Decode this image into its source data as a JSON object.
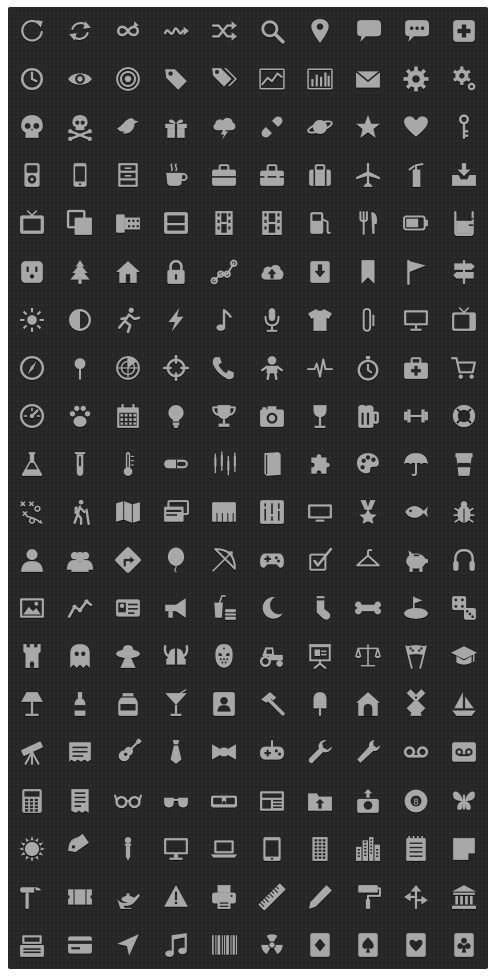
{
  "icon_set": {
    "colors": {
      "background": "#262626",
      "icon_fill": "#a8a8a8",
      "icon_shadow": "#111111",
      "page": "#ffffff"
    },
    "rows": [
      [
        "refresh-icon",
        "sync-icon",
        "repeat-icon",
        "squiggle-icon",
        "shuffle-icon",
        "search-icon",
        "map-pin-icon",
        "speech-bubble-icon",
        "chat-dots-icon",
        "plus-box-icon"
      ],
      [
        "clock-icon",
        "eye-icon",
        "target-icon",
        "tag-icon",
        "tags-icon",
        "line-chart-icon",
        "bar-chart-icon",
        "envelope-icon",
        "gear-icon",
        "gears-icon"
      ],
      [
        "skull-icon",
        "skull-crossbones-icon",
        "bird-icon",
        "gift-icon",
        "storm-cloud-icon",
        "bandage-icon",
        "planet-icon",
        "star-icon",
        "heart-icon",
        "key-icon"
      ],
      [
        "ipod-icon",
        "phone-icon",
        "cabinet-icon",
        "coffee-cup-icon",
        "briefcase-icon",
        "toolbox-icon",
        "suitcase-icon",
        "airplane-icon",
        "fire-extinguisher-icon",
        "inbox-download-icon"
      ],
      [
        "tv-frame-icon",
        "copy-frames-icon",
        "film-roll-icon",
        "inbox-tray-icon",
        "film-strip-icon",
        "film-strip-2-icon",
        "gas-pump-icon",
        "fork-knife-icon",
        "battery-icon",
        "beaker-icon"
      ],
      [
        "power-outlet-icon",
        "pine-tree-icon",
        "home-icon",
        "lock-icon",
        "route-icon",
        "cloud-upload-icon",
        "download-box-icon",
        "bookmark-icon",
        "flag-icon",
        "signpost-icon"
      ],
      [
        "sun-brightness-icon",
        "contrast-icon",
        "running-man-icon",
        "lightning-icon",
        "music-note-icon",
        "microphone-icon",
        "tshirt-icon",
        "paperclip-icon",
        "monitor-icon",
        "television-icon"
      ],
      [
        "compass-icon",
        "pushpin-icon",
        "radar-icon",
        "crosshair-icon",
        "phone-handset-icon",
        "baby-icon",
        "heartbeat-icon",
        "stopwatch-icon",
        "first-aid-kit-icon",
        "shopping-cart-icon"
      ],
      [
        "speedometer-icon",
        "paw-icon",
        "calendar-icon",
        "lightbulb-icon",
        "trophy-icon",
        "camera-icon",
        "wine-glass-icon",
        "beer-mug-icon",
        "dumbbell-icon",
        "lifebuoy-icon"
      ],
      [
        "flask-icon",
        "test-tube-icon",
        "thermometer-icon",
        "pill-icon",
        "candlestick-icon",
        "book-icon",
        "puzzle-icon",
        "palette-icon",
        "umbrella-icon",
        "takeaway-cup-icon"
      ],
      [
        "play-diagram-icon",
        "hiking-icon",
        "map-icon",
        "cards-icon",
        "piano-keys-icon",
        "mixer-sliders-icon",
        "widescreen-icon",
        "medal-star-icon",
        "fish-icon",
        "bug-icon"
      ],
      [
        "user-icon",
        "users-icon",
        "direction-sign-icon",
        "balloon-icon",
        "bow-arrow-icon",
        "gamepad-icon",
        "checkbox-icon",
        "hanger-icon",
        "piggy-bank-icon",
        "headphones-icon"
      ],
      [
        "picture-icon",
        "stock-graph-icon",
        "id-card-icon",
        "megaphone-icon",
        "fast-food-icon",
        "moon-icon",
        "sock-icon",
        "bone-icon",
        "golf-icon",
        "dice-icon"
      ],
      [
        "castle-tower-icon",
        "ghost-icon",
        "ufo-icon",
        "viking-helmet-icon",
        "hockey-mask-icon",
        "tractor-icon",
        "presentation-icon",
        "scales-icon",
        "racing-flags-icon",
        "graduation-cap-icon"
      ],
      [
        "lamp-icon",
        "bottle-icon",
        "jar-icon",
        "cocktail-icon",
        "contact-badge-icon",
        "hammer-icon",
        "popsicle-icon",
        "dog-house-icon",
        "windmill-icon",
        "sailboat-icon"
      ],
      [
        "telescope-icon",
        "receipt-icon",
        "guitar-icon",
        "necktie-icon",
        "bowtie-icon",
        "game-controller-icon",
        "wrench-icon",
        "spanner-icon",
        "voicemail-icon",
        "voicemail-box-icon"
      ],
      [
        "calculator-icon",
        "invoice-icon",
        "glasses-icon",
        "sunglasses-icon",
        "3d-glasses-icon",
        "newspaper-icon",
        "upload-folder-icon",
        "camera-upload-icon",
        "billiard-ball-icon",
        "butterfly-icon"
      ],
      [
        "sun-burst-icon",
        "price-tag-icon",
        "pipette-icon",
        "desktop-icon",
        "laptop-icon",
        "tablet-icon",
        "building-icon",
        "city-skyline-icon",
        "notepad-icon",
        "sticky-note-icon"
      ],
      [
        "claw-hammer-icon",
        "ticket-icon",
        "magic-lamp-icon",
        "warning-icon",
        "printer-icon",
        "ruler-icon",
        "pencil-icon",
        "paint-roller-icon",
        "direction-arrows-icon",
        "bank-icon"
      ],
      [
        "cash-register-icon",
        "credit-card-icon",
        "location-arrow-icon",
        "music-notes-icon",
        "barcode-icon",
        "radiation-icon",
        "diamond-card-icon",
        "spade-card-icon",
        "heart-card-icon",
        "club-card-icon"
      ]
    ]
  }
}
